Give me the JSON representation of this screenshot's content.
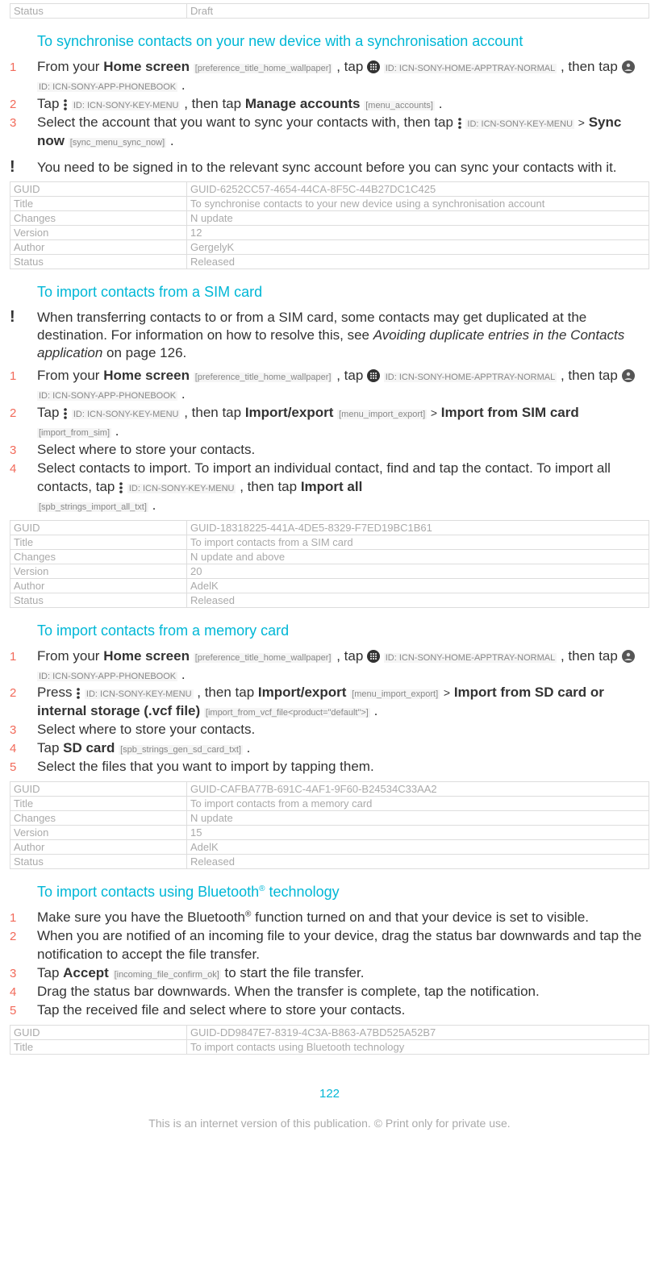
{
  "top_meta": {
    "status_label": "Status",
    "status_value": "Draft"
  },
  "sec1": {
    "heading": "To synchronise contacts on your new device with a synchronisation account",
    "step1_a": "From your ",
    "step1_home": "Home screen",
    "step1_home_tag": "[preference_title_home_wallpaper]",
    "step1_tap": " , tap ",
    "step1_apptray": " ID: ICN-SONY-HOME-APPTRAY-NORMAL",
    "step1_then": " , then tap ",
    "step1_phonebook": " ID: ICN-SONY-APP-PHONEBOOK",
    "step2_tap": "Tap ",
    "step2_keymenu": "ID: ICN-SONY-KEY-MENU",
    "step2_then": " , then tap ",
    "step2_mgacc": "Manage accounts",
    "step2_mgacc_tag": "[menu_accounts]",
    "step3_a": "Select the account that you want to sync your contacts with, then tap ",
    "step3_keymenu": "ID: ICN-SONY-KEY-MENU",
    "step3_gt": ">",
    "step3_syncnow": "Sync now",
    "step3_syncnow_tag": "[sync_menu_sync_now]",
    "note": "You need to be signed in to the relevant sync account before you can sync your contacts with it.",
    "meta": {
      "guid_l": "GUID",
      "guid_v": "GUID-6252CC57-4654-44CA-8F5C-44B27DC1C425",
      "title_l": "Title",
      "title_v": "To synchronise contacts to your new device using a synchronisation account",
      "changes_l": "Changes",
      "changes_v": "N update",
      "version_l": "Version",
      "version_v": "12",
      "author_l": "Author",
      "author_v": "GergelyK",
      "status_l": "Status",
      "status_v": "Released"
    }
  },
  "sec2": {
    "heading": "To import contacts from a SIM card",
    "note_a": "When transferring contacts to or from a SIM card, some contacts may get duplicated at the destination. For information on how to resolve this, see ",
    "note_link": "Avoiding duplicate entries in the Contacts application",
    "note_b": " on page 126.",
    "step2_then": " , then tap ",
    "step2_impexp": "Import/export",
    "step2_impexp_tag": "[menu_import_export]",
    "step2_gt": ">",
    "step2_importsim": "Import from SIM card",
    "step2_importsim_tag": "[import_from_sim]",
    "step3": "Select where to store your contacts.",
    "step4_a": "Select contacts to import. To import an individual contact, find and tap the contact. To import all contacts, tap ",
    "step4_then": " , then tap ",
    "step4_importall": "Import all",
    "step4_importall_tag": "[spb_strings_import_all_txt]",
    "meta": {
      "guid_l": "GUID",
      "guid_v": "GUID-18318225-441A-4DE5-8329-F7ED19BC1B61",
      "title_l": "Title",
      "title_v": "To import contacts from a SIM card",
      "changes_l": "Changes",
      "changes_v": "N update and above",
      "version_l": "Version",
      "version_v": "20",
      "author_l": "Author",
      "author_v": "AdelK",
      "status_l": "Status",
      "status_v": "Released"
    }
  },
  "sec3": {
    "heading": "To import contacts from a memory card",
    "step2_press": "Press ",
    "step2_then": " , then tap ",
    "step2_impexp": "Import/export",
    "step2_impexp_tag": "[menu_import_export]",
    "step2_gt": ">",
    "step2_importsd": "Import from SD card or internal storage (.vcf file)",
    "step2_importsd_tag": "[import_from_vcf_file<product=\"default\">]",
    "step3": "Select where to store your contacts.",
    "step4_tap": "Tap ",
    "step4_sd": "SD card",
    "step4_sd_tag": "[spb_strings_gen_sd_card_txt]",
    "step5": "Select the files that you want to import by tapping them.",
    "meta": {
      "guid_l": "GUID",
      "guid_v": "GUID-CAFBA77B-691C-4AF1-9F60-B24534C33AA2",
      "title_l": "Title",
      "title_v": "To import contacts from a memory card",
      "changes_l": "Changes",
      "changes_v": "N update",
      "version_l": "Version",
      "version_v": "15",
      "author_l": "Author",
      "author_v": "AdelK",
      "status_l": "Status",
      "status_v": "Released"
    }
  },
  "sec4": {
    "heading_a": "To import contacts using Bluetooth",
    "heading_b": " technology",
    "step1_a": "Make sure you have the Bluetooth",
    "step1_b": " function turned on and that your device is set to visible.",
    "step2": "When you are notified of an incoming file to your device, drag the status bar downwards and tap the notification to accept the file transfer.",
    "step3_tap": "Tap ",
    "step3_accept": "Accept",
    "step3_accept_tag": "[incoming_file_confirm_ok]",
    "step3_b": " to start the file transfer.",
    "step4": "Drag the status bar downwards. When the transfer is complete, tap the notification.",
    "step5": "Tap the received file and select where to store your contacts.",
    "meta": {
      "guid_l": "GUID",
      "guid_v": "GUID-DD9847E7-8319-4C3A-B863-A7BD525A52B7",
      "title_l": "Title",
      "title_v": "To import contacts using Bluetooth technology"
    }
  },
  "pagenum": "122",
  "footer": "This is an internet version of this publication. © Print only for private use."
}
